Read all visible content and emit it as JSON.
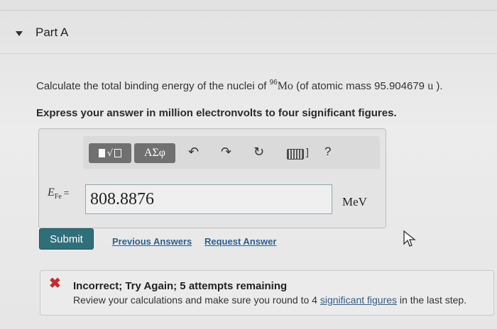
{
  "part": {
    "title": "Part A"
  },
  "question": {
    "prefix": "Calculate the total binding energy of the nuclei of ",
    "isotope_mass_number": "96",
    "isotope_symbol": "Mo",
    "middle": " (of atomic mass 95.904679 ",
    "unit": "u",
    "suffix": " )."
  },
  "instruction": "Express your answer in million electronvolts to four significant figures.",
  "toolbar": {
    "symbols_label": "ΑΣφ",
    "help_label": "?",
    "icons": [
      "templates-icon",
      "greek-symbols-icon",
      "undo-icon",
      "redo-icon",
      "reset-icon",
      "keyboard-icon",
      "help-icon"
    ]
  },
  "answer": {
    "variable": "E",
    "variable_subscript": "Fe",
    "equals": "=",
    "value": "808.8876",
    "unit": "MeV"
  },
  "actions": {
    "submit_label": "Submit",
    "previous_answers_label": "Previous Answers",
    "request_answer_label": "Request Answer"
  },
  "feedback": {
    "title": "Incorrect; Try Again; 5 attempts remaining",
    "text_prefix": "Review your calculations and make sure you round to 4 ",
    "link_text": "significant figures",
    "text_suffix": " in the last step.",
    "status_color": "#c62b2b"
  },
  "colors": {
    "accent": "#2f6f7a",
    "link": "#2f5f8a"
  }
}
